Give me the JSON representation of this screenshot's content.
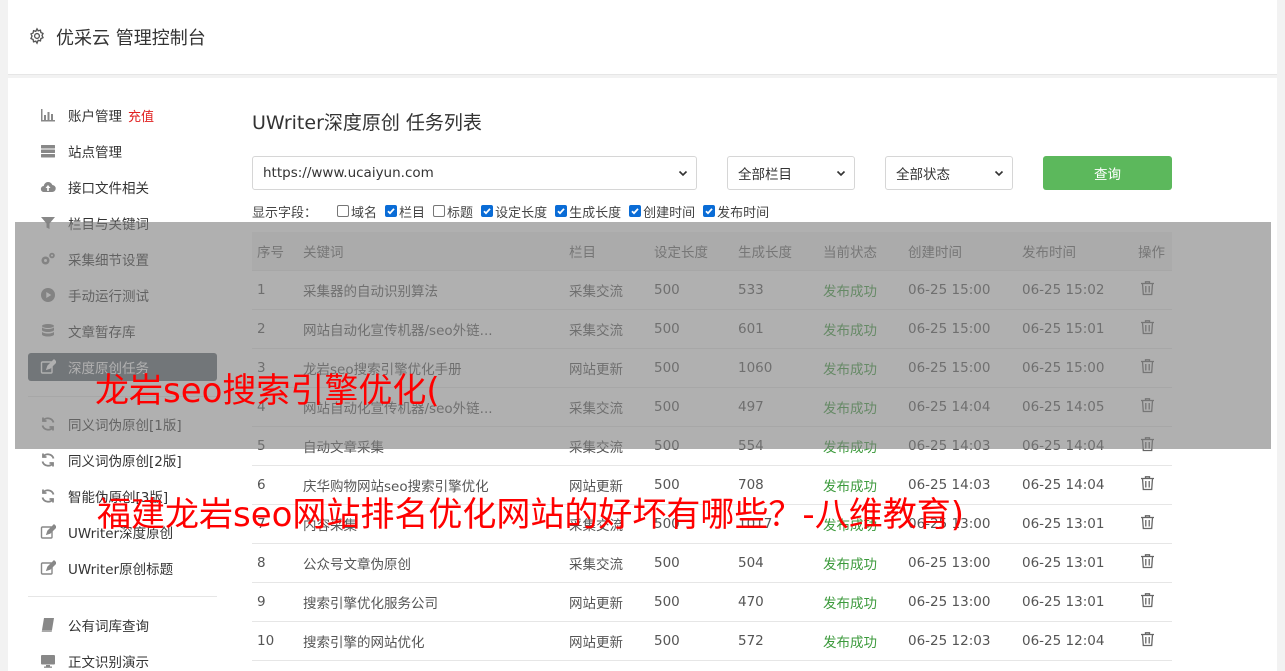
{
  "header": {
    "title": "优采云 管理控制台"
  },
  "sidebar": {
    "items": [
      {
        "label": "账户管理",
        "badge": "充值",
        "icon": "bar-chart-icon"
      },
      {
        "label": "站点管理",
        "icon": "server-icon"
      },
      {
        "label": "接口文件相关",
        "icon": "cloud-upload-icon"
      },
      {
        "label": "栏目与关键词",
        "icon": "filter-icon"
      },
      {
        "label": "采集细节设置",
        "icon": "gears-icon"
      },
      {
        "label": "手动运行测试",
        "icon": "play-icon"
      },
      {
        "label": "文章暂存库",
        "icon": "database-icon"
      },
      {
        "label": "深度原创任务",
        "icon": "edit-icon"
      },
      {
        "label": "同义词伪原创[1版]",
        "icon": "refresh-icon"
      },
      {
        "label": "同义词伪原创[2版]",
        "icon": "refresh-icon"
      },
      {
        "label": "智能伪原创[3版]",
        "icon": "refresh-icon"
      },
      {
        "label": "UWriter深度原创",
        "icon": "edit-icon"
      },
      {
        "label": "UWriter原创标题",
        "icon": "edit-icon"
      },
      {
        "label": "公有词库查询",
        "icon": "book-icon"
      },
      {
        "label": "正文识别演示",
        "icon": "monitor-icon"
      }
    ]
  },
  "main": {
    "title": "UWriter深度原创 任务列表",
    "site_select": "https://www.ucaiyun.com",
    "column_select": "全部栏目",
    "status_select": "全部状态",
    "query_label": "查询",
    "fields_label": "显示字段：",
    "fields": [
      {
        "label": "域名",
        "checked": false
      },
      {
        "label": "栏目",
        "checked": true
      },
      {
        "label": "标题",
        "checked": false
      },
      {
        "label": "设定长度",
        "checked": true
      },
      {
        "label": "生成长度",
        "checked": true
      },
      {
        "label": "创建时间",
        "checked": true
      },
      {
        "label": "发布时间",
        "checked": true
      }
    ],
    "table": {
      "headers": [
        "序号",
        "关键词",
        "栏目",
        "设定长度",
        "生成长度",
        "当前状态",
        "创建时间",
        "发布时间",
        "操作"
      ],
      "rows": [
        [
          "1",
          "采集器的自动识别算法",
          "采集交流",
          "500",
          "533",
          "发布成功",
          "06-25 15:00",
          "06-25 15:02"
        ],
        [
          "2",
          "网站自动化宣传机器/seo外链...",
          "采集交流",
          "500",
          "601",
          "发布成功",
          "06-25 15:00",
          "06-25 15:01"
        ],
        [
          "3",
          "龙岩seo搜索引擎优化手册",
          "网站更新",
          "500",
          "1060",
          "发布成功",
          "06-25 15:00",
          "06-25 15:00"
        ],
        [
          "4",
          "网站自动化宣传机器/seo外链...",
          "采集交流",
          "500",
          "497",
          "发布成功",
          "06-25 14:04",
          "06-25 14:05"
        ],
        [
          "5",
          "自动文章采集",
          "采集交流",
          "500",
          "554",
          "发布成功",
          "06-25 14:03",
          "06-25 14:04"
        ],
        [
          "6",
          "庆华购物网站seo搜索引擎优化",
          "网站更新",
          "500",
          "708",
          "发布成功",
          "06-25 14:03",
          "06-25 14:04"
        ],
        [
          "7",
          "内容采集",
          "采集交流",
          "500",
          "1017",
          "发布成功",
          "06-25 13:00",
          "06-25 13:01"
        ],
        [
          "8",
          "公众号文章伪原创",
          "采集交流",
          "500",
          "504",
          "发布成功",
          "06-25 13:00",
          "06-25 13:01"
        ],
        [
          "9",
          "搜索引擎优化服务公司",
          "网站更新",
          "500",
          "470",
          "发布成功",
          "06-25 13:00",
          "06-25 13:01"
        ],
        [
          "10",
          "搜索引擎的网站优化",
          "网站更新",
          "500",
          "572",
          "发布成功",
          "06-25 12:03",
          "06-25 12:04"
        ]
      ]
    }
  },
  "overlay": {
    "line1": "龙岩seo搜索引擎优化(",
    "line2": "福建龙岩seo网站排名优化网站的好坏有哪些？-八维教育)"
  }
}
